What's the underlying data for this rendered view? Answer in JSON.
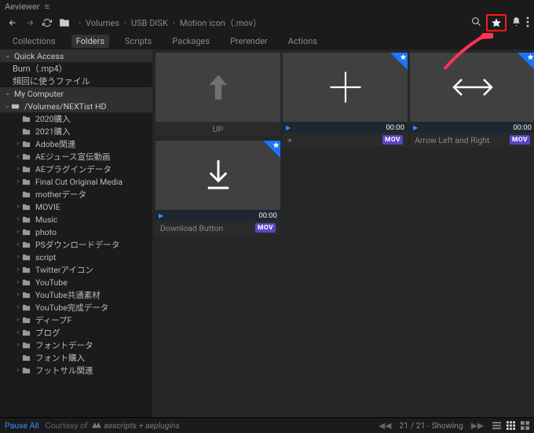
{
  "app": {
    "title": "Aeviewer"
  },
  "nav": {
    "breadcrumb": [
      "Volumes",
      "USB DISK",
      "Motion icon（.mov）"
    ]
  },
  "tabs": {
    "items": [
      "Collections",
      "Folders",
      "Scripts",
      "Packages",
      "Prerender",
      "Actions"
    ],
    "active_index": 1
  },
  "sidebar": {
    "quick_access_header": "Quick Access",
    "quick_access_items": [
      "Burn（.mp4）",
      "頻回に使うファイル"
    ],
    "my_computer_header": "My Computer",
    "root": "/Volumes/NEXTist HD",
    "folders": [
      {
        "name": "2020購入",
        "expandable": false
      },
      {
        "name": "2021購入",
        "expandable": false
      },
      {
        "name": "Adobe関連",
        "expandable": true
      },
      {
        "name": "AEジュース宣伝動画",
        "expandable": true
      },
      {
        "name": "AEプラグインデータ",
        "expandable": true
      },
      {
        "name": "Final Cut Original Media",
        "expandable": true
      },
      {
        "name": "motherデータ",
        "expandable": false
      },
      {
        "name": "MOVIE",
        "expandable": true
      },
      {
        "name": "Music",
        "expandable": true
      },
      {
        "name": "photo",
        "expandable": true
      },
      {
        "name": "PSダウンロードデータ",
        "expandable": true
      },
      {
        "name": "script",
        "expandable": true
      },
      {
        "name": "Twitterアイコン",
        "expandable": true
      },
      {
        "name": "YouTube",
        "expandable": true
      },
      {
        "name": "YouTube共通素材",
        "expandable": true
      },
      {
        "name": "YouTube完成データ",
        "expandable": true
      },
      {
        "name": "ディープF",
        "expandable": true
      },
      {
        "name": "ブログ",
        "expandable": true
      },
      {
        "name": "フォントデータ",
        "expandable": true
      },
      {
        "name": "フォント購入",
        "expandable": false
      },
      {
        "name": "フットサル関連",
        "expandable": true
      }
    ]
  },
  "cards": [
    {
      "label": "UP",
      "time": "",
      "badge": "",
      "star": false,
      "icon": "up"
    },
    {
      "label": "+",
      "time": "00:00",
      "badge": "MOV",
      "star": true,
      "icon": "plus"
    },
    {
      "label": "Arrow Left and Right",
      "time": "00:00",
      "badge": "MOV",
      "star": true,
      "icon": "lr"
    },
    {
      "label": "Download Button",
      "time": "00:00",
      "badge": "MOV",
      "star": true,
      "icon": "down"
    }
  ],
  "footer": {
    "pause": "Pause All",
    "courtesy": "Courtesy of",
    "brand": "aescripts + aeplugins",
    "status_count": "21 / 21",
    "status_word": "Showing"
  }
}
